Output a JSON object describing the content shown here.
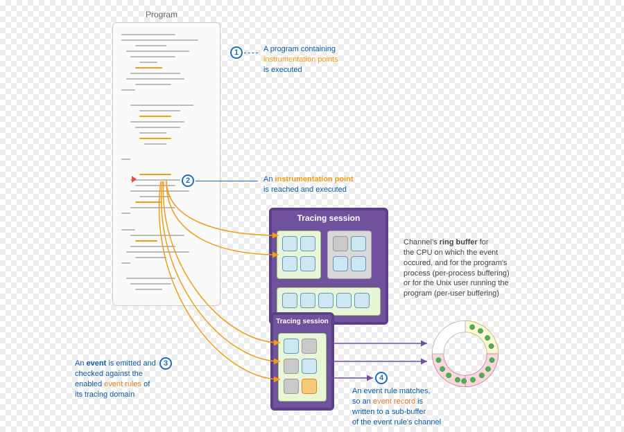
{
  "program_label": "Program",
  "anno1": {
    "l1": "A program containing",
    "hl": "instrumentation points",
    "l3": "is executed"
  },
  "anno2": {
    "pre": "An ",
    "hl": "instrumentation point",
    "l2": "is reached and executed"
  },
  "anno3": {
    "l1a": "An ",
    "hl1": "event",
    "l1b": " is emitted and",
    "l2": "checked against the",
    "l3a": "enabled ",
    "hl2": "event rules",
    "l3b": " of",
    "l4": "its tracing domain"
  },
  "anno4": {
    "l1": "An event rule matches,",
    "l2a": "so an ",
    "hl": "event record",
    "l2b": " is",
    "l3": "written to a sub-buffer",
    "l4": "of the event rule's channel"
  },
  "anno_ring": {
    "l1a": "Channel's ",
    "l1b": "ring buffer",
    "l1c": " for",
    "l2": "the CPU on which the event",
    "l3": "occured, and for the program's",
    "l4": "process (per-process buffering)",
    "l5": "or for the Unix user running the",
    "l6": "program (per-user buffering)"
  },
  "session1_title": "Tracing session",
  "session2_title": "Tracing session",
  "badges": {
    "b1": "1",
    "b2": "2",
    "b3": "3",
    "b4": "4"
  }
}
